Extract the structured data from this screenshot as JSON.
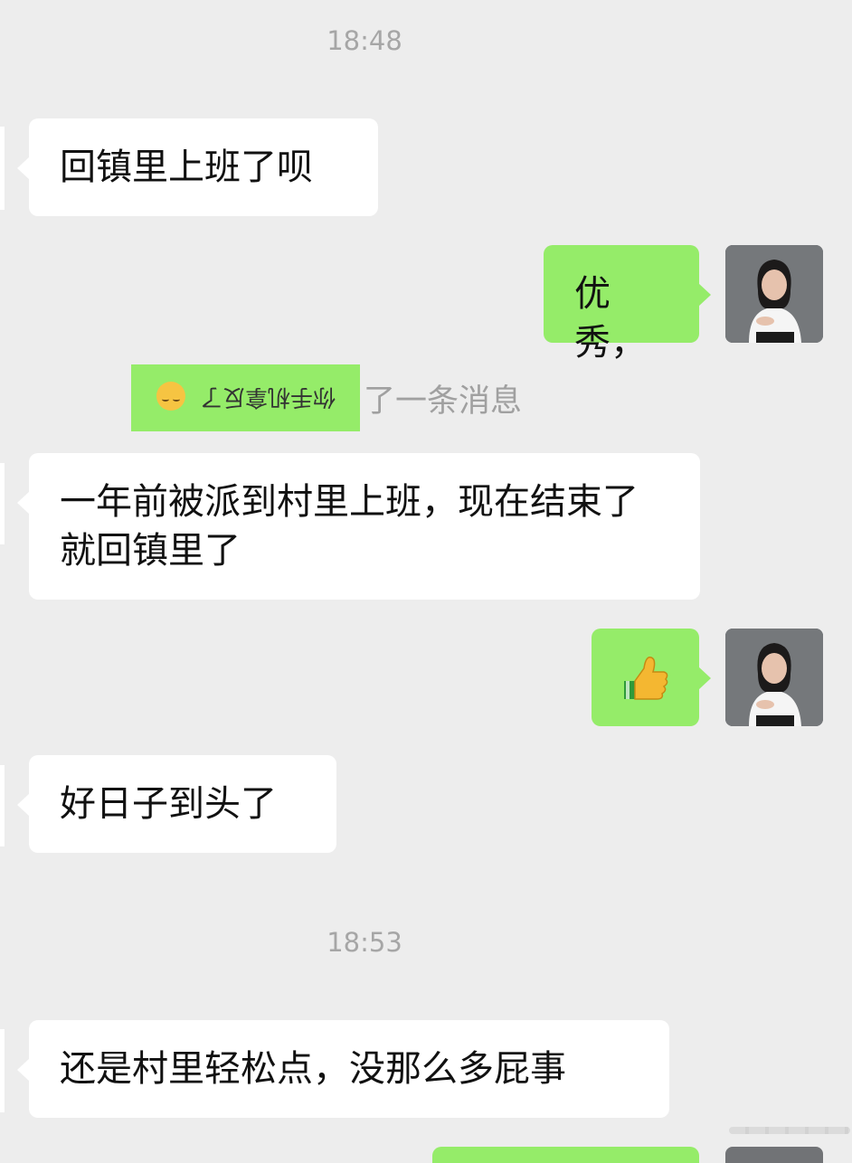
{
  "chat": {
    "timestamps": [
      "18:48",
      "18:53"
    ],
    "messages": [
      {
        "side": "in",
        "text": "回镇里上班了呗"
      },
      {
        "side": "out",
        "text": "优秀，"
      },
      {
        "side": "in",
        "text": "一年前被派到村里上班，现在结束了就回镇里了"
      },
      {
        "side": "out",
        "text": "",
        "emoji": "thumbs-up"
      },
      {
        "side": "in",
        "text": "好日子到头了"
      },
      {
        "side": "in",
        "text": "还是村里轻松点，没那么多屁事"
      }
    ],
    "recall_notice": {
      "flipped_text": "你手机拿反了",
      "suffix": "了一条消息"
    }
  },
  "colors": {
    "background": "#ededed",
    "incoming_bubble": "#ffffff",
    "outgoing_bubble": "#95ec69",
    "timestamp_text": "#a6a6a6"
  }
}
